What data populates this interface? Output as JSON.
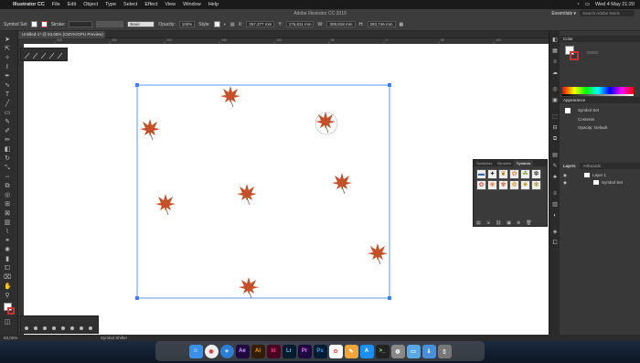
{
  "menubar": {
    "apple": "",
    "app": "Illustrator CC",
    "items": [
      "File",
      "Edit",
      "Object",
      "Type",
      "Select",
      "Effect",
      "View",
      "Window",
      "Help"
    ],
    "clock": "Wed 4 May  21:20"
  },
  "window": {
    "title": "Adobe Illustrator CC 2019",
    "workspace": "Essentials ▾",
    "search_placeholder": "Search Adobe Stock"
  },
  "control": {
    "selection": "Symbol Set",
    "stroke_label": "Stroke:",
    "basic_label": "Basic",
    "opacity_label": "Opacity:",
    "opacity_value": "100%",
    "style_label": "Style:",
    "x_label": "X:",
    "x_value": "257,377 mm",
    "y_label": "Y:",
    "y_value": "176,811 mm",
    "w_label": "W:",
    "w_value": "308,818 mm",
    "h_label": "H:",
    "h_value": "283,746 mm"
  },
  "doc_tab": "Untitled-1* @ 63,05% (CMYK/GPU Preview)",
  "ruler_ticks": [
    "300",
    "250",
    "200",
    "150",
    "100",
    "50",
    "0",
    "50",
    "100"
  ],
  "color_panel": {
    "title": "Color"
  },
  "appearance_panel": {
    "title": "Appearance",
    "object": "Symbol Set",
    "contents": "Contents",
    "opacity_label": "Opacity:",
    "opacity_value": "Default"
  },
  "layers_panel": {
    "tabs": [
      "Layers",
      "Artboards"
    ],
    "layer": "Layer 1",
    "sublayer": "Symbol Set"
  },
  "symbols_panel": {
    "tabs": [
      "Swatches",
      "Brushes",
      "Symbols"
    ],
    "cells": [
      "▬",
      "✦",
      "❦",
      "✿",
      "☘",
      "✽",
      "✿",
      "❀",
      "✾",
      "❁",
      "✸",
      "✻"
    ]
  },
  "status": {
    "zoom": "63,05%",
    "tool": "Symbol Shifter"
  },
  "dock": [
    "Finder",
    "Chrome",
    "Safari",
    "Ae",
    "Ai",
    "Id",
    "Lr",
    "Pr",
    "Ps",
    "Photos",
    "Pages",
    "App Store",
    "Terminal",
    "Photo",
    "Folder",
    "Downloads",
    "Trash"
  ],
  "colors": {
    "leaf": "#c4502a",
    "stem": "#7a5a3a",
    "accent": "#2f7fff"
  }
}
